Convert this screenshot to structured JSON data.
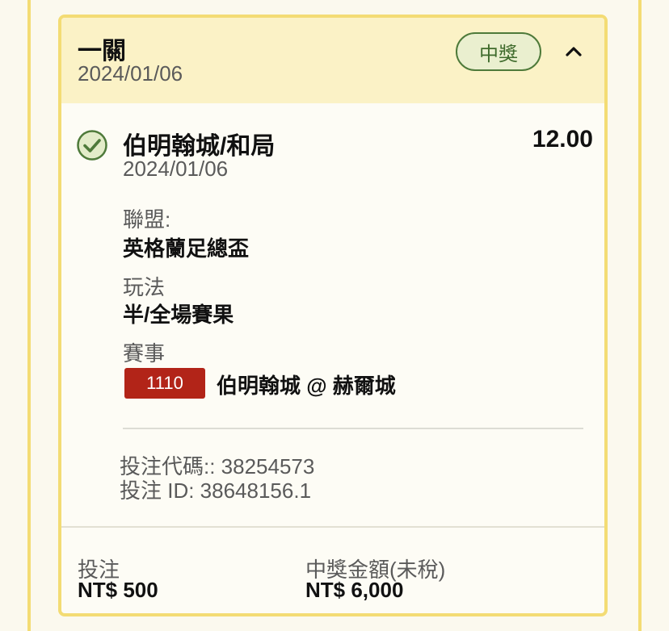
{
  "header": {
    "title": "一關",
    "date": "2024/01/06",
    "status_badge": "中獎",
    "collapse_icon": "chevron-up-icon"
  },
  "selection": {
    "status_icon": "check-circle-icon",
    "name": "伯明翰城/和局",
    "odds": "12.00",
    "date": "2024/01/06"
  },
  "details": {
    "league_label": "聯盟:",
    "league_value": "英格蘭足總盃",
    "market_label": "玩法",
    "market_value": "半/全場賽果",
    "event_label": "賽事",
    "event_id": "1110",
    "event_name": "伯明翰城 @ 赫爾城"
  },
  "codes": {
    "bet_code": "投注代碼:: 38254573",
    "bet_id": "投注 ID: 38648156.1"
  },
  "footer": {
    "stake_label": "投注",
    "stake_value": "NT$ 500",
    "payout_label": "中獎金額(未稅)",
    "payout_value": "NT$ 6,000"
  },
  "colors": {
    "card_border": "#f3dc74",
    "header_bg": "#fbf2c6",
    "win_green": "#4e7a3a",
    "event_badge": "#b22418"
  }
}
